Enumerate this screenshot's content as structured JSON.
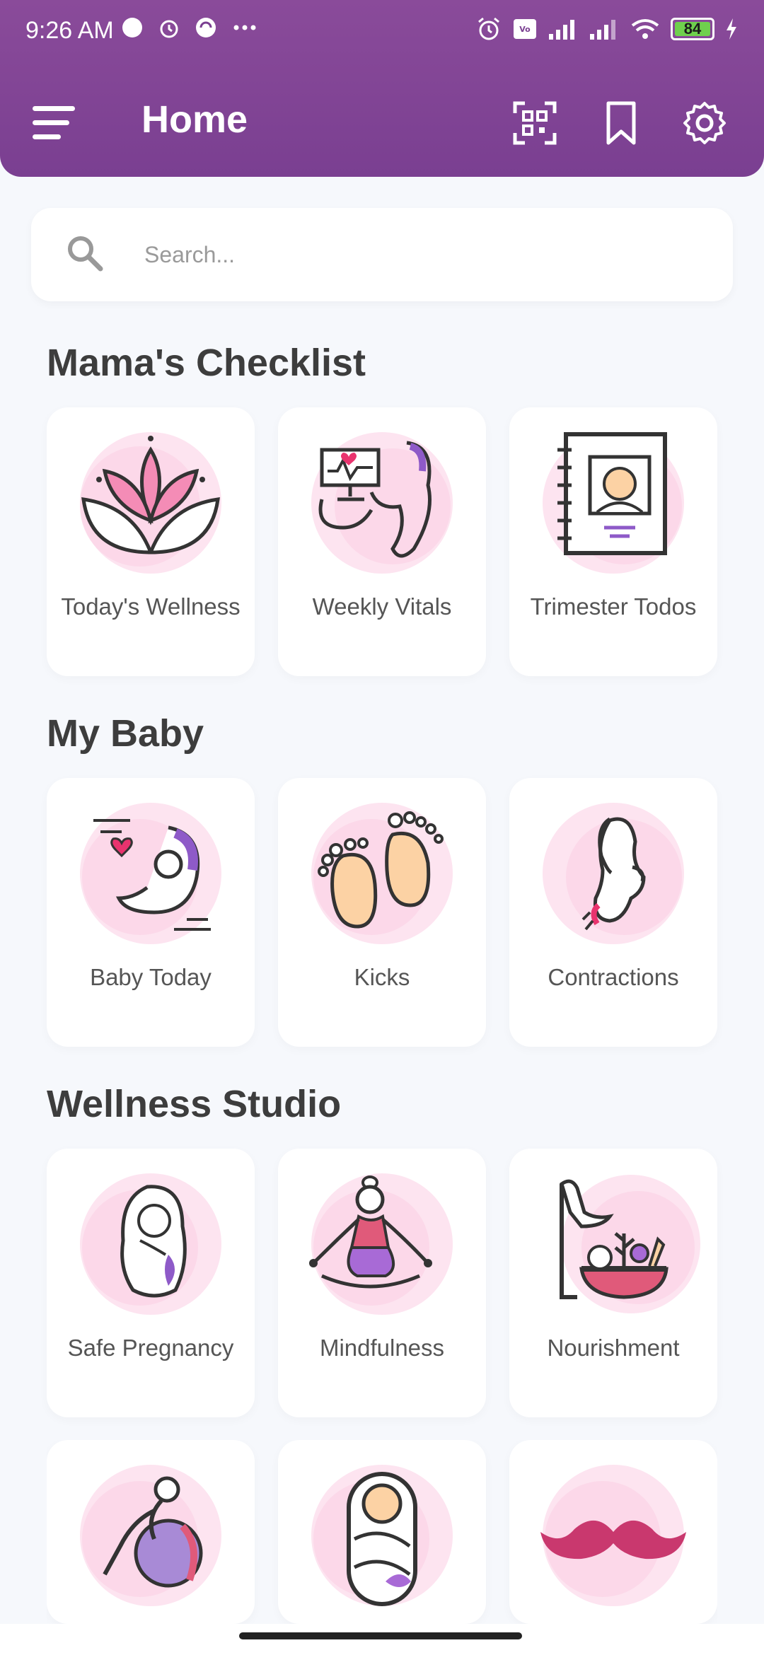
{
  "status_bar": {
    "time": "9:26 AM",
    "battery": "84",
    "icons": [
      "alarm-icon",
      "signal-icon",
      "wifi-icon",
      "battery-icon",
      "charging-icon"
    ]
  },
  "header": {
    "title": "Home",
    "actions": [
      "menu-icon",
      "qr-code-icon",
      "bookmark-icon",
      "gear-icon"
    ],
    "gradient": [
      "#8a4b9a",
      "#7a3f91"
    ]
  },
  "search": {
    "placeholder": "Search..."
  },
  "sections": [
    {
      "title": "Mama's Checklist",
      "items": [
        {
          "label": "Today's Wellness",
          "icon": "lotus-icon"
        },
        {
          "label": "Weekly Vitals",
          "icon": "ultrasound-icon"
        },
        {
          "label": "Trimester Todos",
          "icon": "baby-notebook-icon"
        }
      ]
    },
    {
      "title": "My Baby",
      "items": [
        {
          "label": "Baby Today",
          "icon": "fetus-icon"
        },
        {
          "label": "Kicks",
          "icon": "baby-feet-icon"
        },
        {
          "label": "Contractions",
          "icon": "pregnant-woman-icon"
        }
      ]
    },
    {
      "title": "Wellness Studio",
      "items": [
        {
          "label": "Safe Pregnancy",
          "icon": "mother-embrace-icon"
        },
        {
          "label": "Mindfulness",
          "icon": "meditation-icon"
        },
        {
          "label": "Nourishment",
          "icon": "healthy-food-icon"
        }
      ]
    },
    {
      "title": "",
      "items": [
        {
          "label": "",
          "icon": "exercise-ball-icon"
        },
        {
          "label": "",
          "icon": "swaddled-baby-icon"
        },
        {
          "label": "",
          "icon": "mustache-icon"
        }
      ]
    }
  ],
  "colors": {
    "accent": "#7e4294",
    "pink": "#f4a6c8",
    "background": "#f6f8fc"
  }
}
